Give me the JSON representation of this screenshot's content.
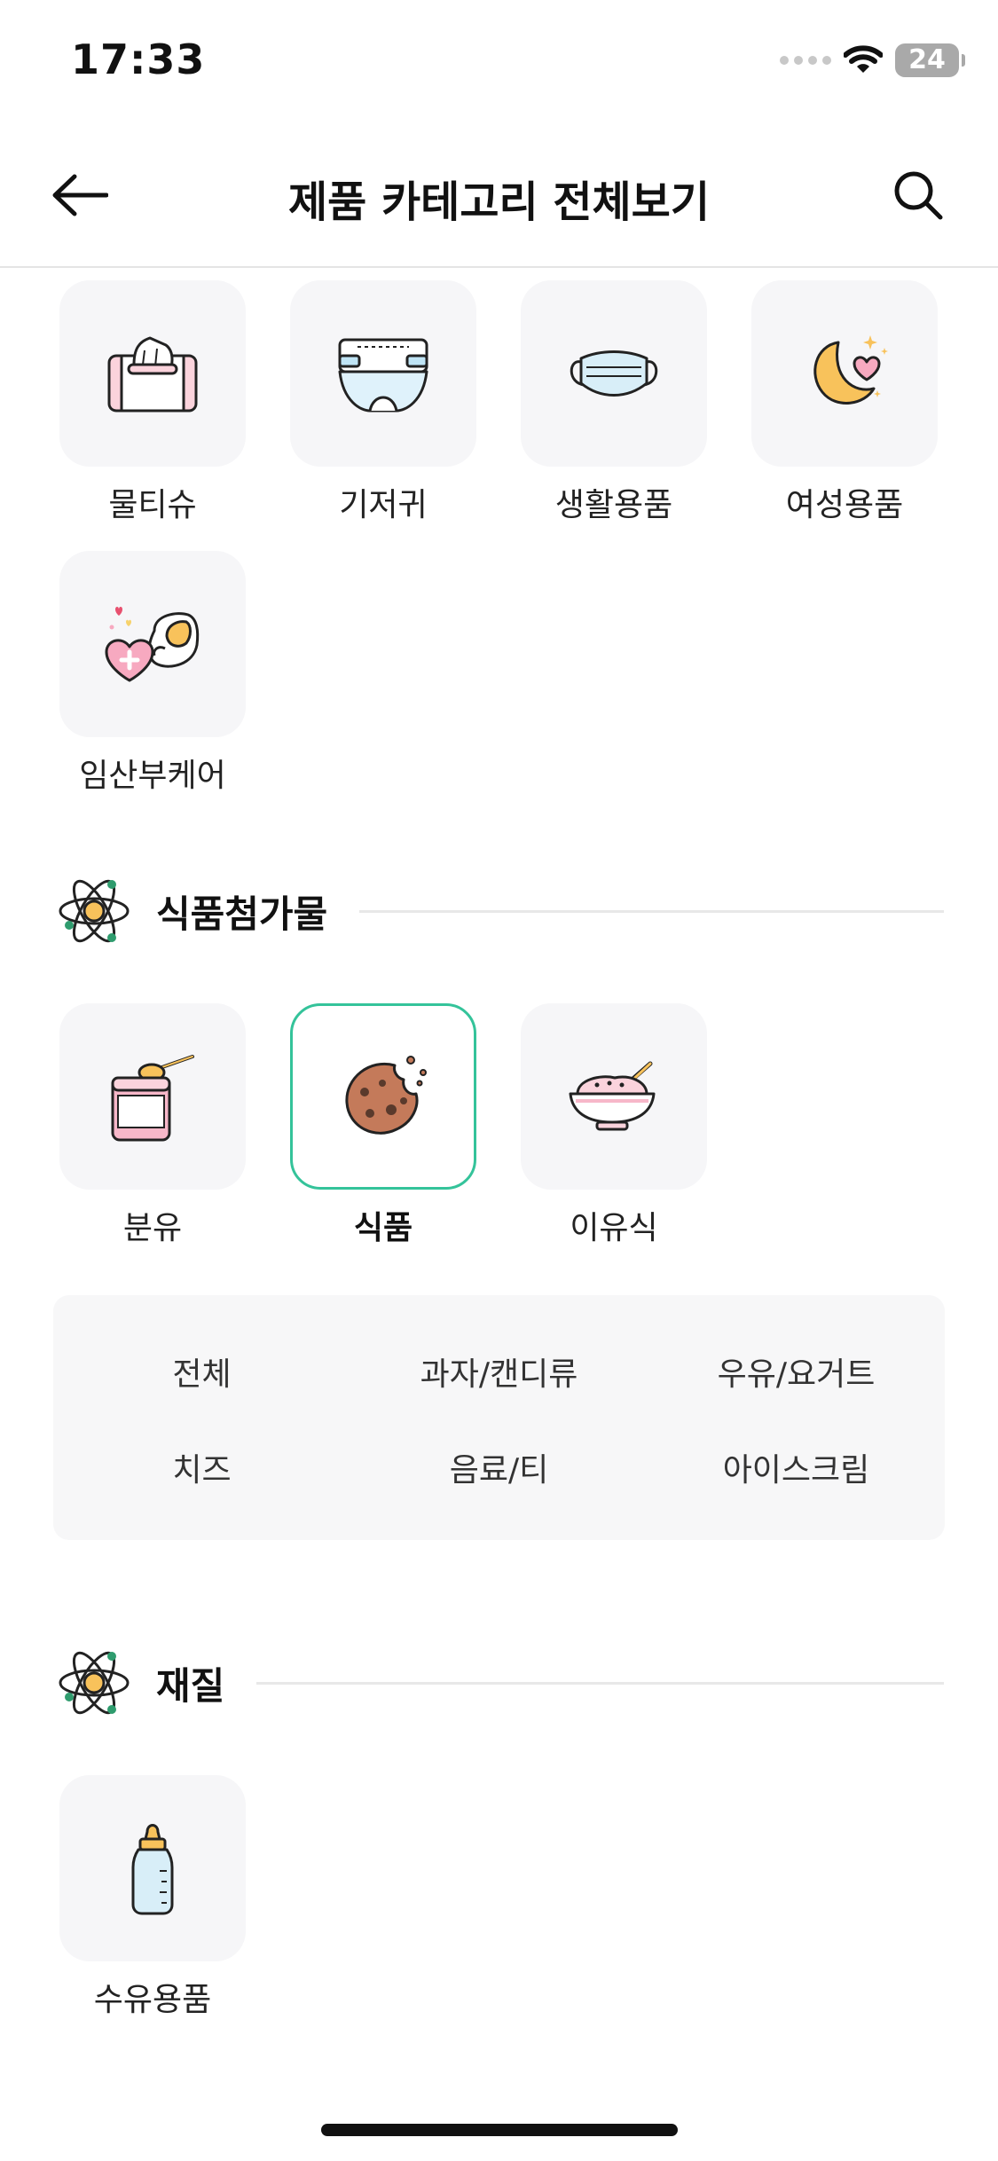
{
  "status_bar": {
    "time": "17:33",
    "battery": "24"
  },
  "header": {
    "title": "제품 카테고리 전체보기"
  },
  "categories_top": [
    {
      "label": "물티슈",
      "icon": "wet-wipes-icon"
    },
    {
      "label": "기저귀",
      "icon": "diaper-icon"
    },
    {
      "label": "생활용품",
      "icon": "mask-icon"
    },
    {
      "label": "여성용품",
      "icon": "moon-heart-icon"
    },
    {
      "label": "임산부케어",
      "icon": "maternity-care-icon"
    }
  ],
  "section_additives": {
    "title": "식품첨가물",
    "items": [
      {
        "label": "분유",
        "icon": "formula-icon"
      },
      {
        "label": "식품",
        "icon": "cookie-icon",
        "selected": true
      },
      {
        "label": "이유식",
        "icon": "baby-food-bowl-icon"
      }
    ],
    "sub_items": [
      "전체",
      "과자/캔디류",
      "우유/요거트",
      "치즈",
      "음료/티",
      "아이스크림"
    ]
  },
  "section_material": {
    "title": "재질",
    "items": [
      {
        "label": "수유용품",
        "icon": "baby-bottle-icon"
      }
    ]
  },
  "colors": {
    "accent": "#34c39a",
    "tile_bg": "#f6f6f8",
    "panel_bg": "#f7f7f8"
  }
}
